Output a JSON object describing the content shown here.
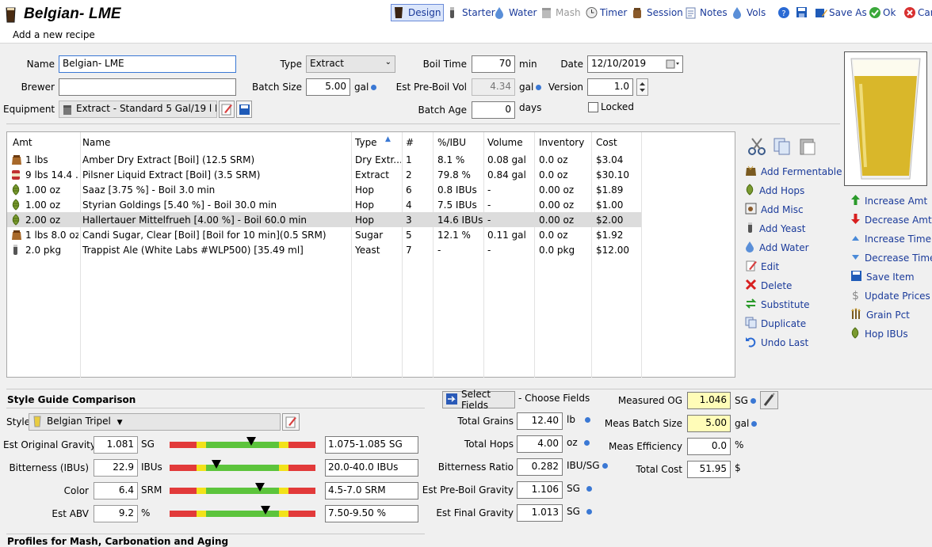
{
  "header": {
    "title": "Belgian- LME",
    "subtitle": "Add a new recipe"
  },
  "toolbar": {
    "design": "Design",
    "starter": "Starter",
    "water": "Water",
    "mash": "Mash",
    "timer": "Timer",
    "session": "Session",
    "notes": "Notes",
    "vols": "Vols",
    "save_as": "Save As",
    "ok": "Ok",
    "cancel": "Can"
  },
  "recipe": {
    "name_label": "Name",
    "name_value": "Belgian- LME",
    "brewer_label": "Brewer",
    "brewer_value": "",
    "equipment_label": "Equipment",
    "equipment_value": "Extract - Standard 5 Gal/19 l Batch",
    "type_label": "Type",
    "type_value": "Extract",
    "batch_size_label": "Batch Size",
    "batch_size_value": "5.00",
    "batch_size_unit": "gal",
    "boil_time_label": "Boil Time",
    "boil_time_value": "70",
    "boil_time_unit": "min",
    "pre_boil_label": "Est Pre-Boil Vol",
    "pre_boil_value": "4.34",
    "pre_boil_unit": "gal",
    "batch_age_label": "Batch Age",
    "batch_age_value": "0",
    "batch_age_unit": "days",
    "date_label": "Date",
    "date_value": "12/10/2019",
    "version_label": "Version",
    "version_value": "1.0",
    "locked_label": "Locked"
  },
  "grid": {
    "columns": [
      "Amt",
      "Name",
      "Type",
      "#",
      "%/IBU",
      "Volume",
      "Inventory",
      "Cost"
    ],
    "rows": [
      {
        "icon": "grain-bag-icon",
        "amt": "1 lbs",
        "name": "Amber Dry Extract [Boil] (12.5 SRM)",
        "type": "Dry Extr...",
        "num": "1",
        "ibu": "8.1 %",
        "volume": "0.08 gal",
        "inventory": "0.0 oz",
        "cost": "$3.04"
      },
      {
        "icon": "extract-can-icon",
        "amt": "9 lbs 14.4 ...",
        "name": "Pilsner Liquid Extract [Boil] (3.5 SRM)",
        "type": "Extract",
        "num": "2",
        "ibu": "79.8 %",
        "volume": "0.84 gal",
        "inventory": "0.0 oz",
        "cost": "$30.10"
      },
      {
        "icon": "hop-icon",
        "amt": "1.00 oz",
        "name": "Saaz [3.75 %] - Boil 3.0 min",
        "type": "Hop",
        "num": "6",
        "ibu": "0.8 IBUs",
        "volume": "-",
        "inventory": "0.00 oz",
        "cost": "$1.89"
      },
      {
        "icon": "hop-icon",
        "amt": "1.00 oz",
        "name": "Styrian Goldings [5.40 %] - Boil 30.0 min",
        "type": "Hop",
        "num": "4",
        "ibu": "7.5 IBUs",
        "volume": "-",
        "inventory": "0.00 oz",
        "cost": "$1.00"
      },
      {
        "icon": "hop-icon",
        "amt": "2.00 oz",
        "name": "Hallertauer Mittelfrueh [4.00 %] - Boil 60.0 min",
        "type": "Hop",
        "num": "3",
        "ibu": "14.6 IBUs",
        "volume": "-",
        "inventory": "0.00 oz",
        "cost": "$2.00"
      },
      {
        "icon": "grain-bag-icon",
        "amt": "1 lbs 8.0 oz",
        "name": "Candi Sugar, Clear [Boil] [Boil for 10 min](0.5 SRM)",
        "type": "Sugar",
        "num": "5",
        "ibu": "12.1 %",
        "volume": "0.11 gal",
        "inventory": "0.0 oz",
        "cost": "$1.92"
      },
      {
        "icon": "yeast-vial-icon",
        "amt": "2.0 pkg",
        "name": "Trappist Ale (White Labs #WLP500) [35.49 ml]",
        "type": "Yeast",
        "num": "7",
        "ibu": "-",
        "volume": "-",
        "inventory": "0.0 pkg",
        "cost": "$12.00"
      }
    ]
  },
  "actions_left": {
    "add_fermentable": "Add Fermentable",
    "add_hops": "Add Hops",
    "add_misc": "Add Misc",
    "add_yeast": "Add Yeast",
    "add_water": "Add Water",
    "edit": "Edit",
    "delete": "Delete",
    "substitute": "Substitute",
    "duplicate": "Duplicate",
    "undo_last": "Undo Last"
  },
  "actions_right": {
    "increase_amt": "Increase Amt",
    "decrease_amt": "Decrease Amt",
    "increase_time": "Increase Time",
    "decrease_time": "Decrease Time",
    "save_item": "Save Item",
    "update_prices": "Update Prices",
    "grain_pct": "Grain Pct",
    "hop_ibus": "Hop IBUs"
  },
  "style": {
    "section_title": "Style Guide Comparison",
    "style_label": "Style",
    "style_value": "Belgian Tripel",
    "rows": [
      {
        "label": "Est Original Gravity",
        "value": "1.081",
        "unit": "SG",
        "range": "1.075-1.085 SG",
        "level": 0.56
      },
      {
        "label": "Bitterness (IBUs)",
        "value": "22.9",
        "unit": "IBUs",
        "range": "20.0-40.0 IBUs",
        "level": 0.32
      },
      {
        "label": "Color",
        "value": "6.4",
        "unit": "SRM",
        "range": "4.5-7.0 SRM",
        "level": 0.62
      },
      {
        "label": "Est ABV",
        "value": "9.2",
        "unit": "%",
        "range": "7.50-9.50 %",
        "level": 0.66
      }
    ]
  },
  "stats": {
    "select_fields": "Select Fields",
    "choose_fields": "- Choose Fields",
    "total_grains_label": "Total Grains",
    "total_grains_value": "12.40",
    "total_grains_unit": "lb",
    "total_hops_label": "Total Hops",
    "total_hops_value": "4.00",
    "total_hops_unit": "oz",
    "bitterness_ratio_label": "Bitterness Ratio",
    "bitterness_ratio_value": "0.282",
    "bitterness_ratio_unit": "IBU/SG",
    "pre_boil_gravity_label": "Est Pre-Boil Gravity",
    "pre_boil_gravity_value": "1.106",
    "pre_boil_gravity_unit": "SG",
    "final_gravity_label": "Est Final Gravity",
    "final_gravity_value": "1.013",
    "final_gravity_unit": "SG"
  },
  "measured": {
    "og_label": "Measured OG",
    "og_value": "1.046",
    "og_unit": "SG",
    "batch_label": "Meas Batch Size",
    "batch_value": "5.00",
    "batch_unit": "gal",
    "eff_label": "Meas Efficiency",
    "eff_value": "0.0",
    "eff_unit": "%",
    "cost_label": "Total Cost",
    "cost_value": "51.95",
    "cost_unit": "$"
  },
  "profiles": {
    "title": "Profiles for Mash, Carbonation and Aging"
  },
  "colors": {
    "accent": "#1a3a9a",
    "beer": "#d9b72a",
    "highlight": "#fffcb8",
    "bar_red": "#e23a3a",
    "bar_yellow": "#f2e21a",
    "bar_green": "#5cc43c"
  }
}
